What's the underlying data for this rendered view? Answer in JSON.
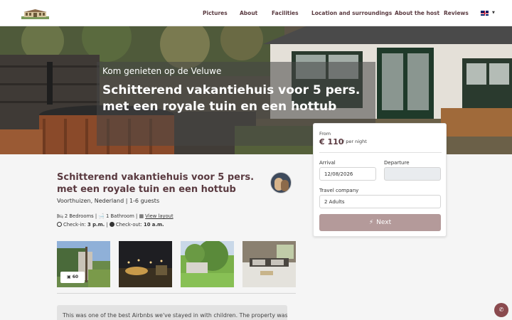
{
  "nav": {
    "items": [
      {
        "label": "Pictures"
      },
      {
        "label": "About"
      },
      {
        "label": "Facilities"
      },
      {
        "label": "Location and surroundings"
      },
      {
        "label": "About the host"
      },
      {
        "label": "Reviews"
      }
    ],
    "language_icon": "uk-flag-icon"
  },
  "hero": {
    "subtitle": "Kom genieten op de Veluwe",
    "title": "Schitterend vakantiehuis voor 5 pers. met een royale tuin en een hottub"
  },
  "booking": {
    "from_label": "From",
    "price": "€ 110",
    "per_night": "/ per night",
    "arrival_label": "Arrival",
    "arrival_value": "12/08/2026",
    "departure_label": "Departure",
    "departure_value": "",
    "company_label": "Travel company",
    "company_value": "2 Adults",
    "next_label": "Next"
  },
  "listing": {
    "title": "Schitterend vakantiehuis voor 5 pers. met een royale tuin en een hottub",
    "location": "Voorthuizen, Nederland | 1-6 guests",
    "bedrooms": "2 Bedrooms",
    "bathrooms": "1 Bathroom",
    "view_layout": "View layout",
    "checkin_label": "Check-in:",
    "checkin_time": "3 p.m.",
    "checkout_label": "Check-out:",
    "checkout_time": "10 a.m.",
    "photo_count": "60"
  },
  "review": {
    "text": "This was one of the best Airbnbs we've stayed in with children. The property was"
  },
  "colors": {
    "brand": "#5a3a40",
    "button": "#b49a9a",
    "whatsapp": "#8a4a4e"
  }
}
